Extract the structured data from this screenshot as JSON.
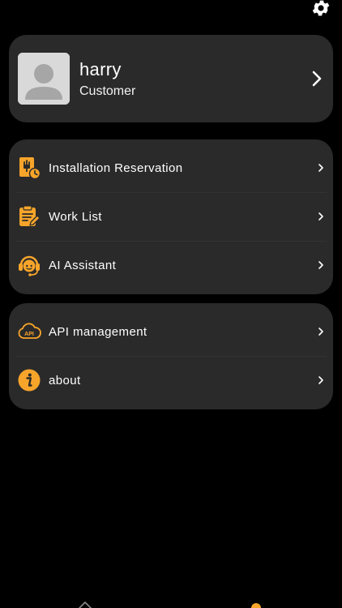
{
  "theme": {
    "background": "#000000",
    "card": "#2a2a2a",
    "accent": "#f7a52a",
    "text": "#ffffff"
  },
  "header": {
    "settings_icon": "gear-icon"
  },
  "profile": {
    "name": "harry",
    "role": "Customer",
    "avatar_icon": "avatar-placeholder-icon",
    "chevron_icon": "chevron-right-icon"
  },
  "menu_primary": [
    {
      "label": "Installation Reservation",
      "icon": "charger-clock-icon"
    },
    {
      "label": "Work List",
      "icon": "clipboard-edit-icon"
    },
    {
      "label": "AI Assistant",
      "icon": "headset-assistant-icon"
    }
  ],
  "menu_secondary": [
    {
      "label": "API management",
      "icon": "api-cloud-icon"
    },
    {
      "label": "about",
      "icon": "info-icon"
    }
  ],
  "bottom_nav": [
    {
      "icon": "home-icon",
      "active": false
    },
    {
      "icon": "profile-icon",
      "active": true
    }
  ]
}
